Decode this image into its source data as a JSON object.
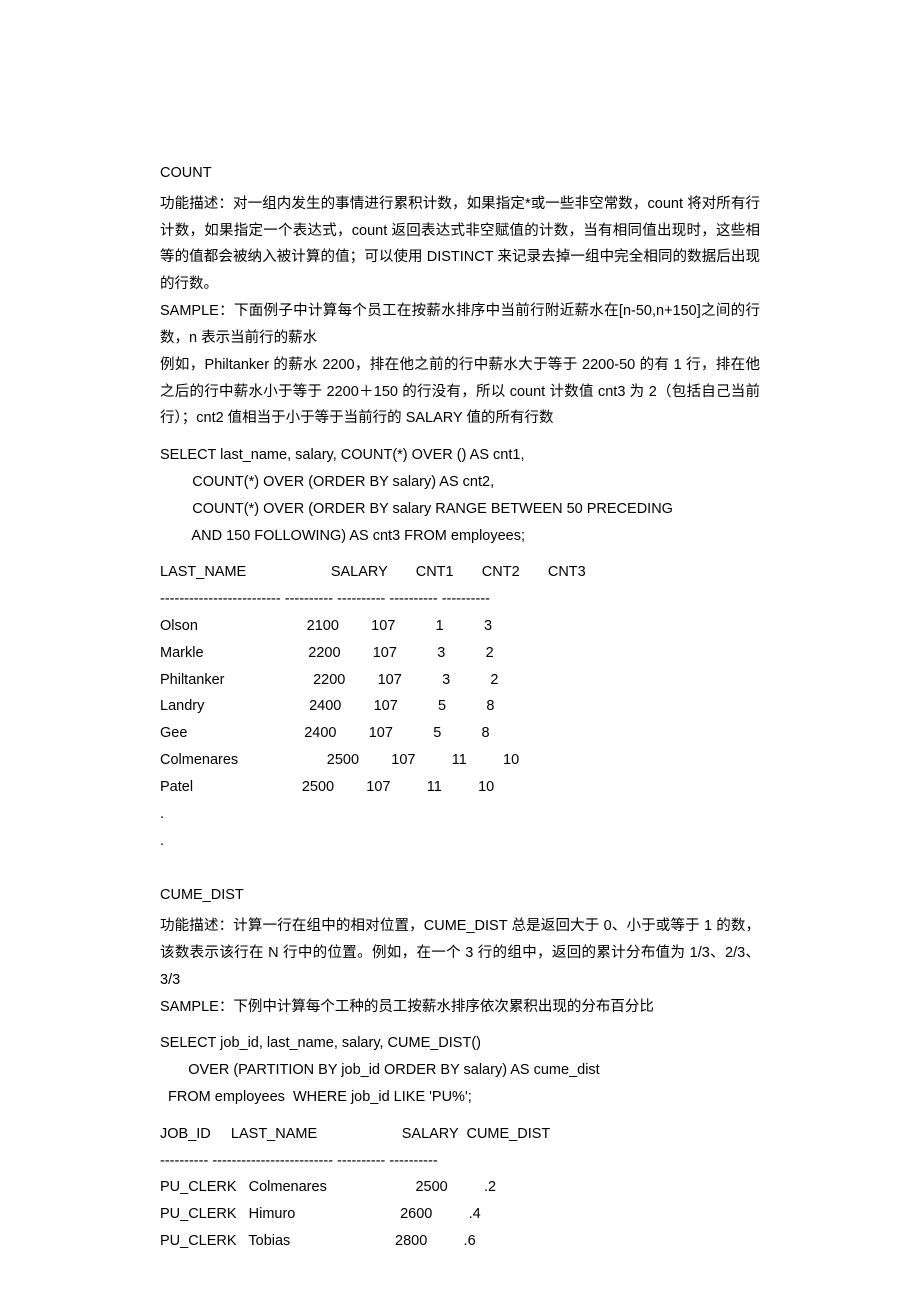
{
  "section1": {
    "title": "COUNT",
    "p1": "功能描述：对一组内发生的事情进行累积计数，如果指定*或一些非空常数，count 将对所有行计数，如果指定一个表达式，count 返回表达式非空赋值的计数，当有相同值出现时，这些相等的值都会被纳入被计算的值；可以使用 DISTINCT 来记录去掉一组中完全相同的数据后出现的行数。",
    "p2": "SAMPLE：下面例子中计算每个员工在按薪水排序中当前行附近薪水在[n-50,n+150]之间的行数，n 表示当前行的薪水",
    "p3": "例如，Philtanker 的薪水 2200，排在他之前的行中薪水大于等于 2200-50 的有 1 行，排在他之后的行中薪水小于等于 2200＋150 的行没有，所以 count 计数值 cnt3 为 2（包括自己当前行）；cnt2 值相当于小于等于当前行的 SALARY 值的所有行数",
    "sql": "SELECT last_name, salary, COUNT(*) OVER () AS cnt1,\n        COUNT(*) OVER (ORDER BY salary) AS cnt2,\n        COUNT(*) OVER (ORDER BY salary RANGE BETWEEN 50 PRECEDING\n        AND 150 FOLLOWING) AS cnt3 FROM employees;",
    "table": "LAST_NAME                     SALARY       CNT1       CNT2       CNT3\n------------------------- ---------- ---------- ---------- ----------\nOlson                           2100        107          1          3\nMarkle                          2200        107          3          2\nPhiltanker                      2200        107          3          2\nLandry                          2400        107          5          8\nGee                             2400        107          5          8\nColmenares                      2500        107         11         10\nPatel                           2500        107         11         10\n.\n."
  },
  "section2": {
    "title": "CUME_DIST",
    "p1": "功能描述：计算一行在组中的相对位置，CUME_DIST 总是返回大于 0、小于或等于 1 的数，该数表示该行在 N 行中的位置。例如，在一个 3 行的组中，返回的累计分布值为 1/3、2/3、3/3",
    "p2": "SAMPLE：下例中计算每个工种的员工按薪水排序依次累积出现的分布百分比",
    "sql": "SELECT job_id, last_name, salary, CUME_DIST()\n       OVER (PARTITION BY job_id ORDER BY salary) AS cume_dist\n  FROM employees  WHERE job_id LIKE 'PU%';",
    "table": "JOB_ID     LAST_NAME                     SALARY  CUME_DIST\n---------- ------------------------- ---------- ----------\nPU_CLERK   Colmenares                      2500         .2\nPU_CLERK   Himuro                          2600         .4\nPU_CLERK   Tobias                          2800         .6"
  }
}
